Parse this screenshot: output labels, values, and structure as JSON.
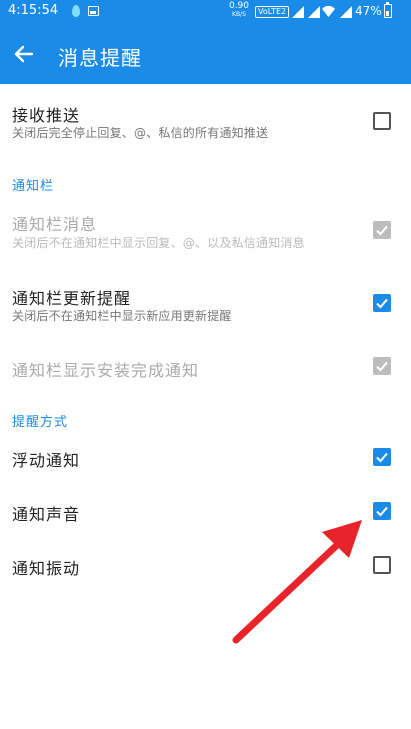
{
  "status_bar": {
    "time": "4:15:54",
    "net_speed_value": "0.90",
    "net_speed_unit": "KB/S",
    "volte": "VoLTE2",
    "battery": "47%"
  },
  "app_bar": {
    "title": "消息提醒",
    "back_icon": "arrow-left-icon"
  },
  "accent_color": "#1a8ce8",
  "settings": {
    "receive_push": {
      "title": "接收推送",
      "subtitle": "关闭后完全停止回复、@、私信的所有通知推送",
      "checked": false
    },
    "section_notification_bar": "通知栏",
    "bar_message": {
      "title": "通知栏消息",
      "subtitle": "关闭后不在通知栏中显示回复、@、以及私信通知消息",
      "checked": true,
      "enabled": false
    },
    "bar_update": {
      "title": "通知栏更新提醒",
      "subtitle": "关闭后不在通知栏中显示新应用更新提醒",
      "checked": true,
      "enabled": true
    },
    "bar_install": {
      "title": "通知栏显示安装完成通知",
      "checked": true,
      "enabled": false
    },
    "section_reminder_mode": "提醒方式",
    "float_notify": {
      "title": "浮动通知",
      "checked": true
    },
    "notify_sound": {
      "title": "通知声音",
      "checked": true
    },
    "notify_vibrate": {
      "title": "通知振动",
      "checked": false
    }
  },
  "annotation": {
    "arrow_color": "#e8232a",
    "points_to": "notify_sound checkbox"
  }
}
